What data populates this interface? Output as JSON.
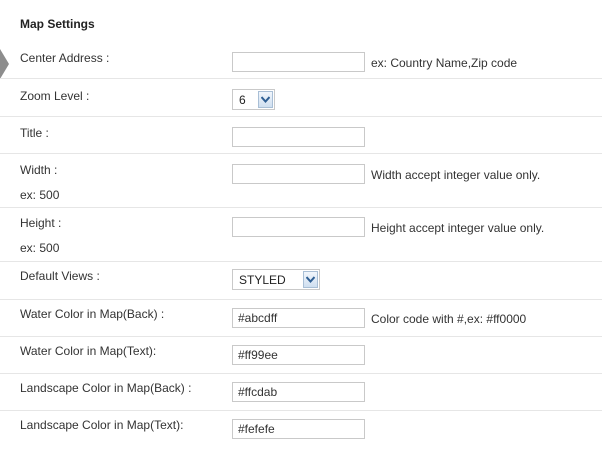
{
  "section": {
    "title": "Map Settings"
  },
  "fields": {
    "center_address": {
      "label": "Center Address :",
      "value": "",
      "hint": "ex: Country Name,Zip code"
    },
    "zoom_level": {
      "label": "Zoom Level :",
      "selected": "6"
    },
    "title": {
      "label": "Title :",
      "value": ""
    },
    "width": {
      "label": "Width :",
      "sublabel": "ex: 500",
      "value": "",
      "hint": "Width accept integer value only."
    },
    "height": {
      "label": "Height :",
      "sublabel": "ex: 500",
      "value": "",
      "hint": "Height accept integer value only."
    },
    "default_views": {
      "label": "Default Views :",
      "selected": "STYLED"
    },
    "water_color_back": {
      "label": "Water Color in Map(Back) :",
      "value": "#abcdff",
      "hint": "Color code with #,ex: #ff0000"
    },
    "water_color_text": {
      "label": "Water Color in Map(Text):",
      "value": "#ff99ee"
    },
    "landscape_color_back": {
      "label": "Landscape Color in Map(Back) :",
      "value": "#ffcdab"
    },
    "landscape_color_text": {
      "label": "Landscape Color in Map(Text):",
      "value": "#fefefe"
    }
  },
  "icons": {
    "side_arrow": "triangle-right-icon",
    "dropdown": "chevron-down-icon"
  },
  "colors": {
    "border": "#c9c9c9",
    "divider": "#e6e6e6",
    "text": "#333333",
    "dropdown_button": "#cfdff0",
    "side_arrow": "#8d8d8d"
  }
}
